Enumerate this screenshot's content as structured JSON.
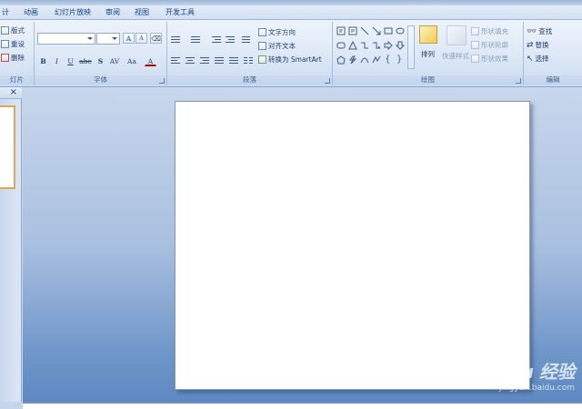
{
  "menubar": {
    "items": [
      "计",
      "动画",
      "幻灯片放映",
      "审阅",
      "视图",
      "开发工具"
    ]
  },
  "ribbon": {
    "slides_group": {
      "label": "灯片",
      "layout": "版式",
      "reset": "重设",
      "delete": "删除"
    },
    "font_group": {
      "label": "字体",
      "grow": "A",
      "shrink": "A",
      "bold": "B",
      "italic": "I",
      "underline": "U",
      "strike": "abe",
      "shadow": "S",
      "spacing": "AV",
      "case": "Aa",
      "color": "A"
    },
    "paragraph_group": {
      "label": "段落",
      "text_direction": "文字方向",
      "align_text": "对齐文本",
      "convert_smartart": "转换为 SmartArt"
    },
    "drawing_group": {
      "label": "绘图",
      "arrange": "排列",
      "quick_styles": "快速样式",
      "shape_fill": "形状填充",
      "shape_outline": "形状轮廓",
      "shape_effects": "形状效果"
    },
    "editing_group": {
      "label": "编辑",
      "find": "查找",
      "replace": "替换",
      "select": "选择"
    }
  },
  "left_pane": {
    "close": "×"
  },
  "watermark": {
    "logo": "Bai du 经验",
    "url": "jingyan.baidu.com"
  },
  "colors": {
    "accent": "#15428b",
    "thumb_border": "#e0a657",
    "workspace_bottom": "#5d88c1"
  }
}
